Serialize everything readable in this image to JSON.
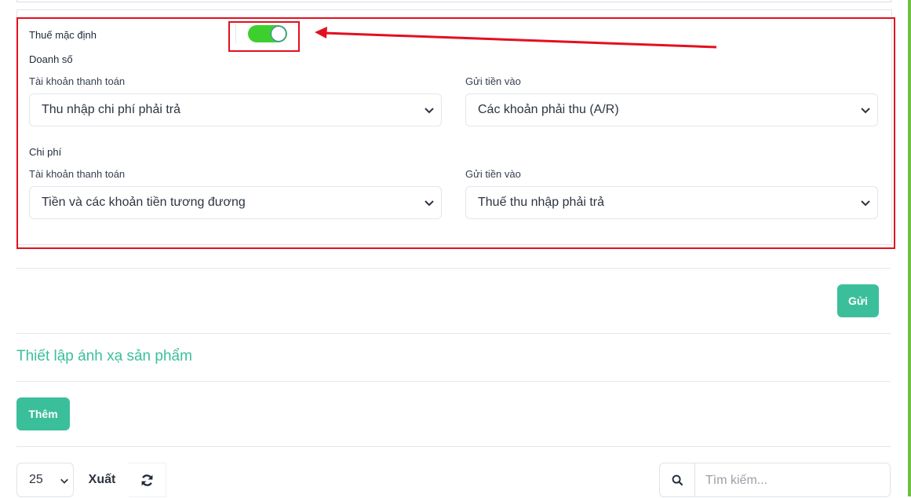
{
  "tax_settings": {
    "default_tax_label": "Thuế mặc định",
    "default_tax_enabled": true,
    "sales": {
      "heading": "Doanh số",
      "payment_account_label": "Tài khoản thanh toán",
      "payment_account_value": "Thu nhập chi phí phải trả",
      "deposit_to_label": "Gửi tiền vào",
      "deposit_to_value": "Các khoản phải thu (A/R)"
    },
    "expenses": {
      "heading": "Chi phí",
      "payment_account_label": "Tài khoản thanh toán",
      "payment_account_value": "Tiền và các khoản tiền tương đương",
      "deposit_to_label": "Gửi tiền vào",
      "deposit_to_value": "Thuế thu nhập phải trả"
    }
  },
  "submit_label": "Gửi",
  "product_mapping": {
    "title": "Thiết lập ánh xạ sản phẩm",
    "add_label": "Thêm"
  },
  "table_controls": {
    "page_size": "25",
    "export_label": "Xuất",
    "search_placeholder": "Tìm kiếm..."
  },
  "annotation": {
    "highlight_color": "#e3101f",
    "accent_color": "#3bbf9b",
    "toggle_on_color": "#3dcf2e"
  }
}
